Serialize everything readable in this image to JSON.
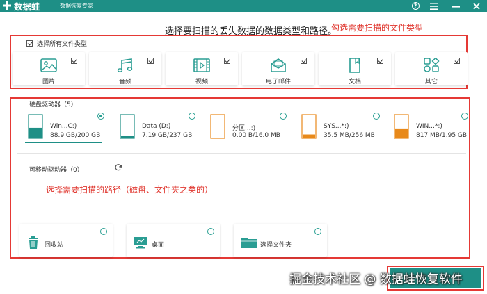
{
  "titlebar": {
    "app_name": "数据蛙",
    "subtitle": "数据恢复专家",
    "help_icon": "help-circle-icon",
    "menu_icon": "hamburger-menu-icon",
    "minimize_icon": "minimize-icon",
    "close_icon": "close-icon",
    "bg_color": "#1e8f86"
  },
  "instruction": "选择要扫描的丢失数据的数据类型和路径。",
  "notes": {
    "file_types": "勾选需要扫描的文件类型",
    "paths": "选择需要扫描的路径（磁盘、文件夹之类的）",
    "note_color": "#e53935"
  },
  "file_types": {
    "select_all_label": "选择所有文件类型",
    "select_all_checked": true,
    "items": [
      {
        "label": "图片",
        "icon": "image-icon",
        "checked": true
      },
      {
        "label": "音频",
        "icon": "music-note-icon",
        "checked": true
      },
      {
        "label": "视频",
        "icon": "video-film-icon",
        "checked": true
      },
      {
        "label": "电子邮件",
        "icon": "email-envelope-icon",
        "checked": true
      },
      {
        "label": "文档",
        "icon": "document-icon",
        "checked": true
      },
      {
        "label": "其它",
        "icon": "grid-apps-icon",
        "checked": true
      }
    ]
  },
  "hard_drives": {
    "title": "硬盘驱动器（5）",
    "items": [
      {
        "name": "Win...C:)",
        "size": "88.9 GB/200 GB",
        "used_fraction": 0.44,
        "fill_color": "#1e8f86",
        "selected": true
      },
      {
        "name": "Data (D:)",
        "size": "7.19 GB/237 GB",
        "used_fraction": 0.03,
        "fill_color": "#1e8f86",
        "selected": false
      },
      {
        "name": "分区...:)",
        "size": "0.00  B/16.0 MB",
        "used_fraction": 0.0,
        "fill_color": "#e8891a",
        "selected": false
      },
      {
        "name": "SYS...*:)",
        "size": "35.5 MB/256 MB",
        "used_fraction": 0.14,
        "fill_color": "#e8891a",
        "selected": false
      },
      {
        "name": "WIN...*:)",
        "size": "817 MB/1.95 GB",
        "used_fraction": 0.41,
        "fill_color": "#e8891a",
        "selected": false
      }
    ]
  },
  "removable": {
    "title": "可移动驱动器（0）",
    "refresh_icon": "refresh-icon"
  },
  "locations": [
    {
      "label": "回收站",
      "icon": "recycle-bin-icon",
      "selected": false
    },
    {
      "label": "桌面",
      "icon": "desktop-monitor-icon",
      "selected": false
    },
    {
      "label": "选择文件夹",
      "icon": "folder-icon",
      "selected": false
    }
  ],
  "watermark": {
    "prefix": "掘金技术社区 @ ",
    "brand": "数据蛙恢复软件"
  }
}
